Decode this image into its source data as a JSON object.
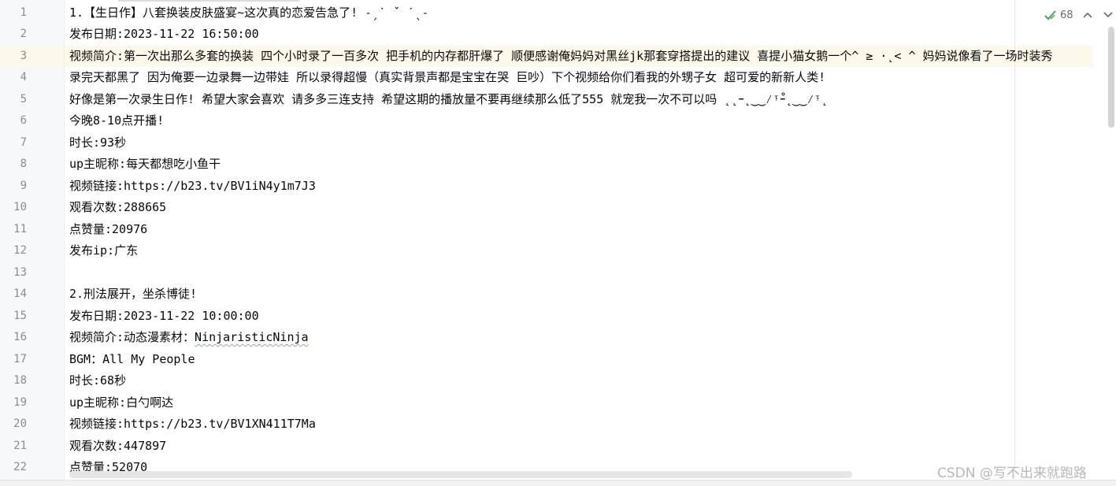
{
  "editor": {
    "inspection_count": "68",
    "lines": [
      {
        "num": "1",
        "text": "1.【生日作】八套换装皮肤盛宴~这次真的恋爱告急了! ˗ˏˋ ˇ ˊˎ˗"
      },
      {
        "num": "2",
        "text": "发布日期:2023-11-22 16:50:00"
      },
      {
        "num": "3",
        "text": "视频简介:第一次出那么多套的换装 四个小时录了一百多次 把手机的内存都肝爆了 顺便感谢俺妈妈对黑丝jk那套穿搭提出的建议 喜提小猫女鹅一个^ ≥ ·˛< ^ 妈妈说像看了一场时装秀"
      },
      {
        "num": "4",
        "text": "录完天都黑了 因为俺要一边录舞一边带娃 所以录得超慢（真实背景声都是宝宝在哭 巨吵）下个视频给你们看我的外甥子女 超可爱的新新人类!"
      },
      {
        "num": "5",
        "text": "好像是第一次录生日作! 希望大家会喜欢 请多多三连支持 希望这期的播放量不要再继续那么低了555 就宠我一次不可以吗 ˛˛ｰ˛‿‿⁄ᵎ̊ｰ˛‿‿⁄ᵎ˛"
      },
      {
        "num": "6",
        "text": "今晚8-10点开播!"
      },
      {
        "num": "7",
        "text": "时长:93秒"
      },
      {
        "num": "8",
        "text": "up主昵称:每天都想吃小鱼干"
      },
      {
        "num": "9",
        "text": "视频链接:https://b23.tv/BV1iN4y1m7J3"
      },
      {
        "num": "10",
        "text": "观看次数:288665"
      },
      {
        "num": "11",
        "text": "点赞量:20976"
      },
      {
        "num": "12",
        "text": "发布ip:广东"
      },
      {
        "num": "13",
        "text": ""
      },
      {
        "num": "14",
        "text": "2.刑法展开，坐杀博徒!"
      },
      {
        "num": "15",
        "text": "发布日期:2023-11-22 10:00:00"
      },
      {
        "num": "16",
        "text": "视频简介:动态漫素材：",
        "squiggle": "NinjaristicNinja"
      },
      {
        "num": "17",
        "text": "BGM：All My People"
      },
      {
        "num": "18",
        "text": "时长:68秒"
      },
      {
        "num": "19",
        "text": "up主昵称:白勺啊达"
      },
      {
        "num": "20",
        "text": "视频链接:https://b23.tv/BV1XN411T7Ma"
      },
      {
        "num": "21",
        "text": "观看次数:447897"
      },
      {
        "num": "22",
        "text": "点赞量:52070"
      }
    ]
  },
  "watermark": "CSDN @写不出来就跑路"
}
